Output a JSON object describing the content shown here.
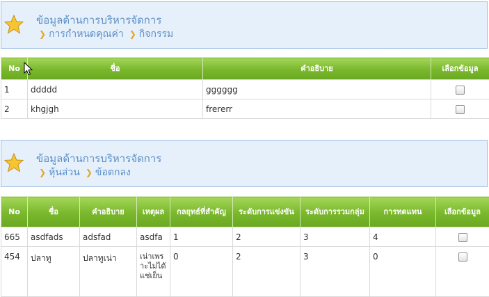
{
  "panel1": {
    "title": "ข้อมูลด้านการบริหารจัดการ",
    "crumb1": "การกำหนดคุณค่า",
    "crumb2": "กิจกรรม"
  },
  "table1": {
    "headers": [
      "No",
      "ชื่อ",
      "คำอธิบาย",
      "เลือกข้อมูล"
    ],
    "rows": [
      {
        "no": "1",
        "name": "ddddd",
        "desc": "gggggg"
      },
      {
        "no": "2",
        "name": "khgjgh",
        "desc": "frererr"
      }
    ]
  },
  "panel2": {
    "title": "ข้อมูลด้านการบริหารจัดการ",
    "crumb1": "หุ้นส่วน",
    "crumb2": "ข้อตกลง"
  },
  "table2": {
    "headers": [
      "No",
      "ชื่อ",
      "คำอธิบาย",
      "เหตุผล",
      "กลยุทธ์ที่สำคัญ",
      "ระดับการแข่งขัน",
      "ระดับการรวมกลุ่ม",
      "การทดแทน",
      "เลือกข้อมูล"
    ],
    "rows": [
      {
        "no": "665",
        "name": "asdfads",
        "desc": "adsfad",
        "reason": "asdfa",
        "strategy": "1",
        "competition": "2",
        "grouping": "3",
        "substitution": "4"
      },
      {
        "no": "454",
        "name": "ปลาทู",
        "desc": "ปลาทูเน่า",
        "reason": "เน่าเพราะไม่ได้แช่เย็น",
        "strategy": "0",
        "competition": "2",
        "grouping": "3",
        "substitution": "0"
      }
    ]
  },
  "colors": {
    "accent_green": "#79b72c",
    "panel_bg": "#e6f0fb",
    "title_blue": "#5b8fc7",
    "chevron": "#e3a323"
  },
  "icons": [
    "star-icon",
    "chevron-right-icon",
    "mouse-cursor-icon",
    "checkbox-icon"
  ]
}
